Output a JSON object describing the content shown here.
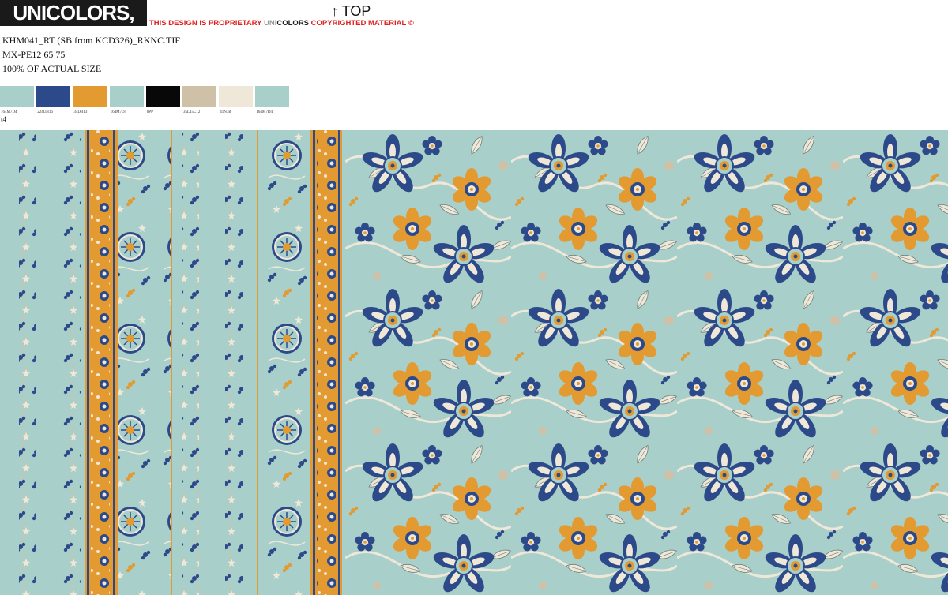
{
  "header": {
    "logo_text": "UNICOLORS, INC.",
    "notice_part1": "THIS DESIGN IS PROPRIETARY ",
    "notice_uni": "UNI",
    "notice_colors": "COLORS",
    "notice_part2": " COPYRIGHTED MATERIAL ©",
    "top_label": "↑ TOP"
  },
  "meta": {
    "filename": "KHM041_RT (SB from KCD326)_RKNC.TIF",
    "code": "MX-PE12 65 75",
    "scale": "100% OF ACTUAL SIZE"
  },
  "swatches": [
    {
      "label": "164M7D4",
      "color": "#a9cfca"
    },
    {
      "label": "224UH16",
      "color": "#2c4a8a"
    },
    {
      "label": "34DB13",
      "color": "#e29a31"
    },
    {
      "label": "164M7D4",
      "color": "#a9cfca"
    },
    {
      "label": "0PP",
      "color": "#080808"
    },
    {
      "label": "35L15C12",
      "color": "#cfc1a7"
    },
    {
      "label": "41N7B",
      "color": "#efe8d9"
    },
    {
      "label": "164M7D4",
      "color": "#a9cfca"
    }
  ],
  "swatch_overflow_label": "t4",
  "colors": {
    "ground": "#a9cfca",
    "navy": "#2c4a8a",
    "orange": "#e29a31",
    "cream": "#efe8d9",
    "tan": "#cfc1a7",
    "accent_red": "#d22"
  }
}
